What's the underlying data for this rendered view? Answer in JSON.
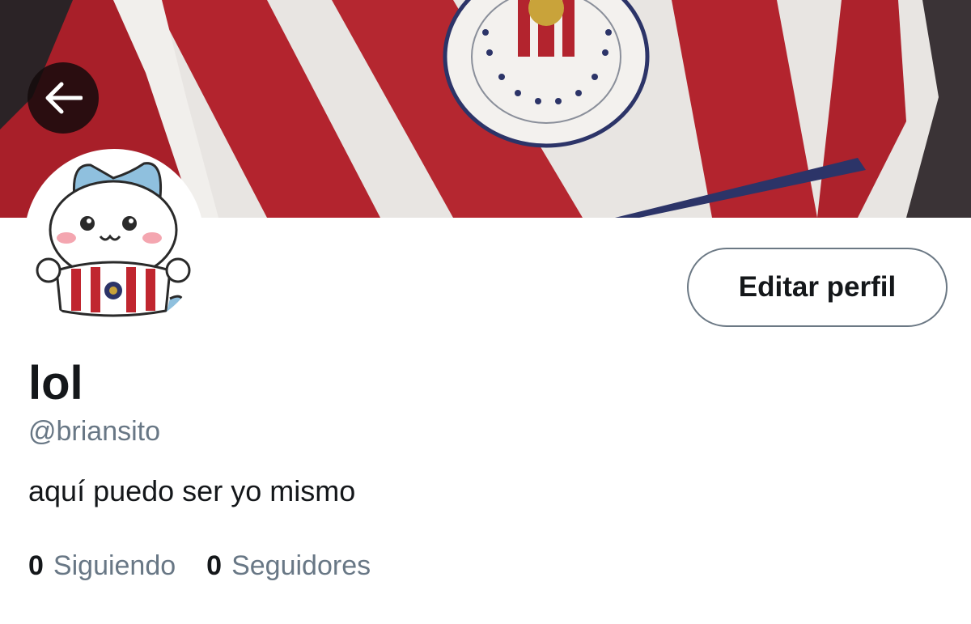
{
  "header": {
    "back_icon": "arrow-left-icon",
    "banner_colors": {
      "red": "#b3242e",
      "white": "#eeebe8",
      "navy": "#2c3468"
    }
  },
  "profile": {
    "avatar_icon": "cat-avatar",
    "edit_button_label": "Editar perfil",
    "display_name": "lol",
    "handle": "@briansito",
    "bio": "aquí puedo ser yo mismo"
  },
  "stats": {
    "following_count": "0",
    "following_label": "Siguiendo",
    "followers_count": "0",
    "followers_label": "Seguidores"
  },
  "theme": {
    "text": "#14171a",
    "muted": "#687785",
    "border": "#6b7884"
  }
}
